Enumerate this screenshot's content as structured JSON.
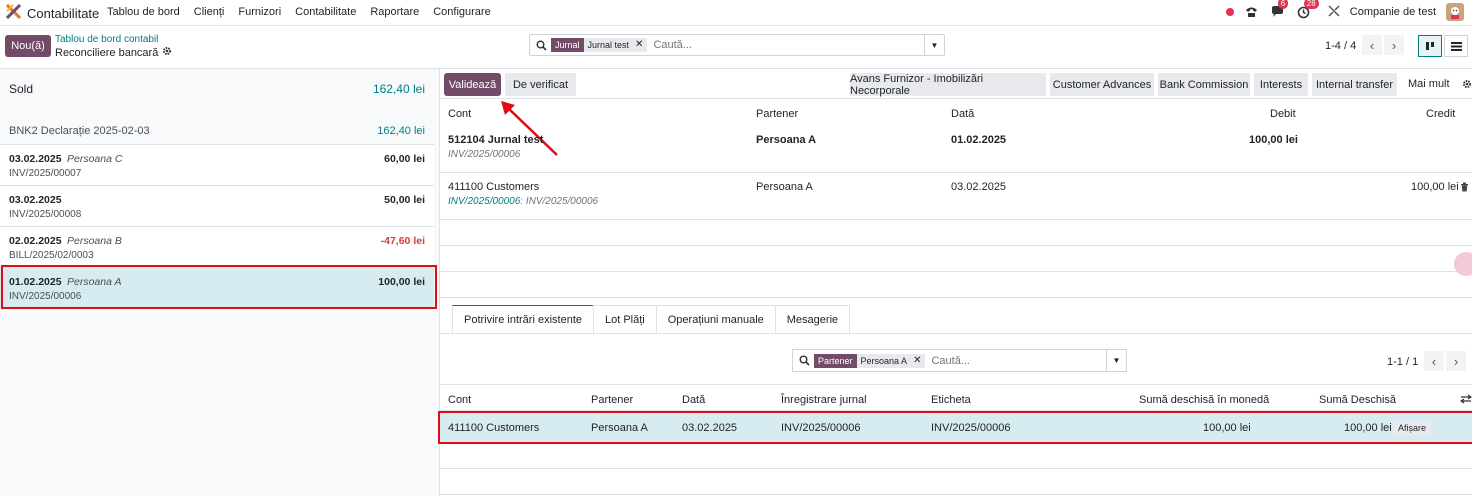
{
  "topnav": {
    "app_name": "Contabilitate",
    "menu": [
      "Tablou de bord",
      "Clienți",
      "Furnizori",
      "Contabilitate",
      "Raportare",
      "Configurare"
    ],
    "messages_badge": "6",
    "activities_badge": "28",
    "company": "Companie de test"
  },
  "control_panel": {
    "new_label": "Nou(ă)",
    "breadcrumb_parent": "Tablou de bord contabil",
    "breadcrumb_current": "Reconciliere bancară",
    "search": {
      "facet_key": "Jurnal",
      "facet_value": "Jurnal test",
      "placeholder": "Caută..."
    },
    "pager": "1-4 / 4"
  },
  "left": {
    "sold_label": "Sold",
    "sold_value": "162,40 lei",
    "statement_name": "BNK2 Declarație 2025-02-03",
    "statement_value": "162,40 lei",
    "lines": [
      {
        "date": "03.02.2025",
        "partner": "Persoana C",
        "ref": "INV/2025/00007",
        "amount": "60,00 lei",
        "negative": false,
        "selected": false
      },
      {
        "date": "03.02.2025",
        "partner": "",
        "ref": "INV/2025/00008",
        "amount": "50,00 lei",
        "negative": false,
        "selected": false
      },
      {
        "date": "02.02.2025",
        "partner": "Persoana B",
        "ref": "BILL/2025/02/0003",
        "amount": "-47,60 lei",
        "negative": true,
        "selected": false
      },
      {
        "date": "01.02.2025",
        "partner": "Persoana A",
        "ref": "INV/2025/00006",
        "amount": "100,00 lei",
        "negative": false,
        "selected": true
      }
    ]
  },
  "reconcile": {
    "validate_label": "Validează",
    "to_check_label": "De verificat",
    "models": [
      "Avans Furnizor - Imobilizări Necorporale",
      "Customer Advances",
      "Bank Commission",
      "Interests",
      "Internal transfer"
    ],
    "more_label": "Mai mult",
    "headers": {
      "account": "Cont",
      "partner": "Partener",
      "date": "Dată",
      "debit": "Debit",
      "credit": "Credit"
    },
    "lines": [
      {
        "account": "512104 Jurnal test",
        "sub": "INV/2025/00006",
        "partner": "Persoana A",
        "date": "01.02.2025",
        "debit": "100,00 lei",
        "credit": ""
      },
      {
        "account": "411100 Customers",
        "sub_link": "INV/2025/00006",
        "sub_rest": ": INV/2025/00006",
        "partner": "Persoana A",
        "date": "03.02.2025",
        "debit": "",
        "credit": "100,00 lei"
      }
    ]
  },
  "tabs": [
    "Potrivire intrări existente",
    "Lot Plăți",
    "Operațiuni manuale",
    "Mesagerie"
  ],
  "amls": {
    "search": {
      "facet_key": "Partener",
      "facet_value": "Persoana A",
      "placeholder": "Caută..."
    },
    "pager": "1-1 / 1",
    "headers": {
      "account": "Cont",
      "partner": "Partener",
      "date": "Dată",
      "move": "Înregistrare jurnal",
      "label": "Eticheta",
      "amount_currency": "Sumă deschisă în monedă",
      "amount": "Sumă Deschisă"
    },
    "rows": [
      {
        "account": "411100 Customers",
        "partner": "Persoana A",
        "date": "03.02.2025",
        "move": "INV/2025/00006",
        "label": "INV/2025/00006",
        "amount_currency": "100,00 lei",
        "amount": "100,00 lei",
        "action": "Afișare"
      }
    ]
  }
}
